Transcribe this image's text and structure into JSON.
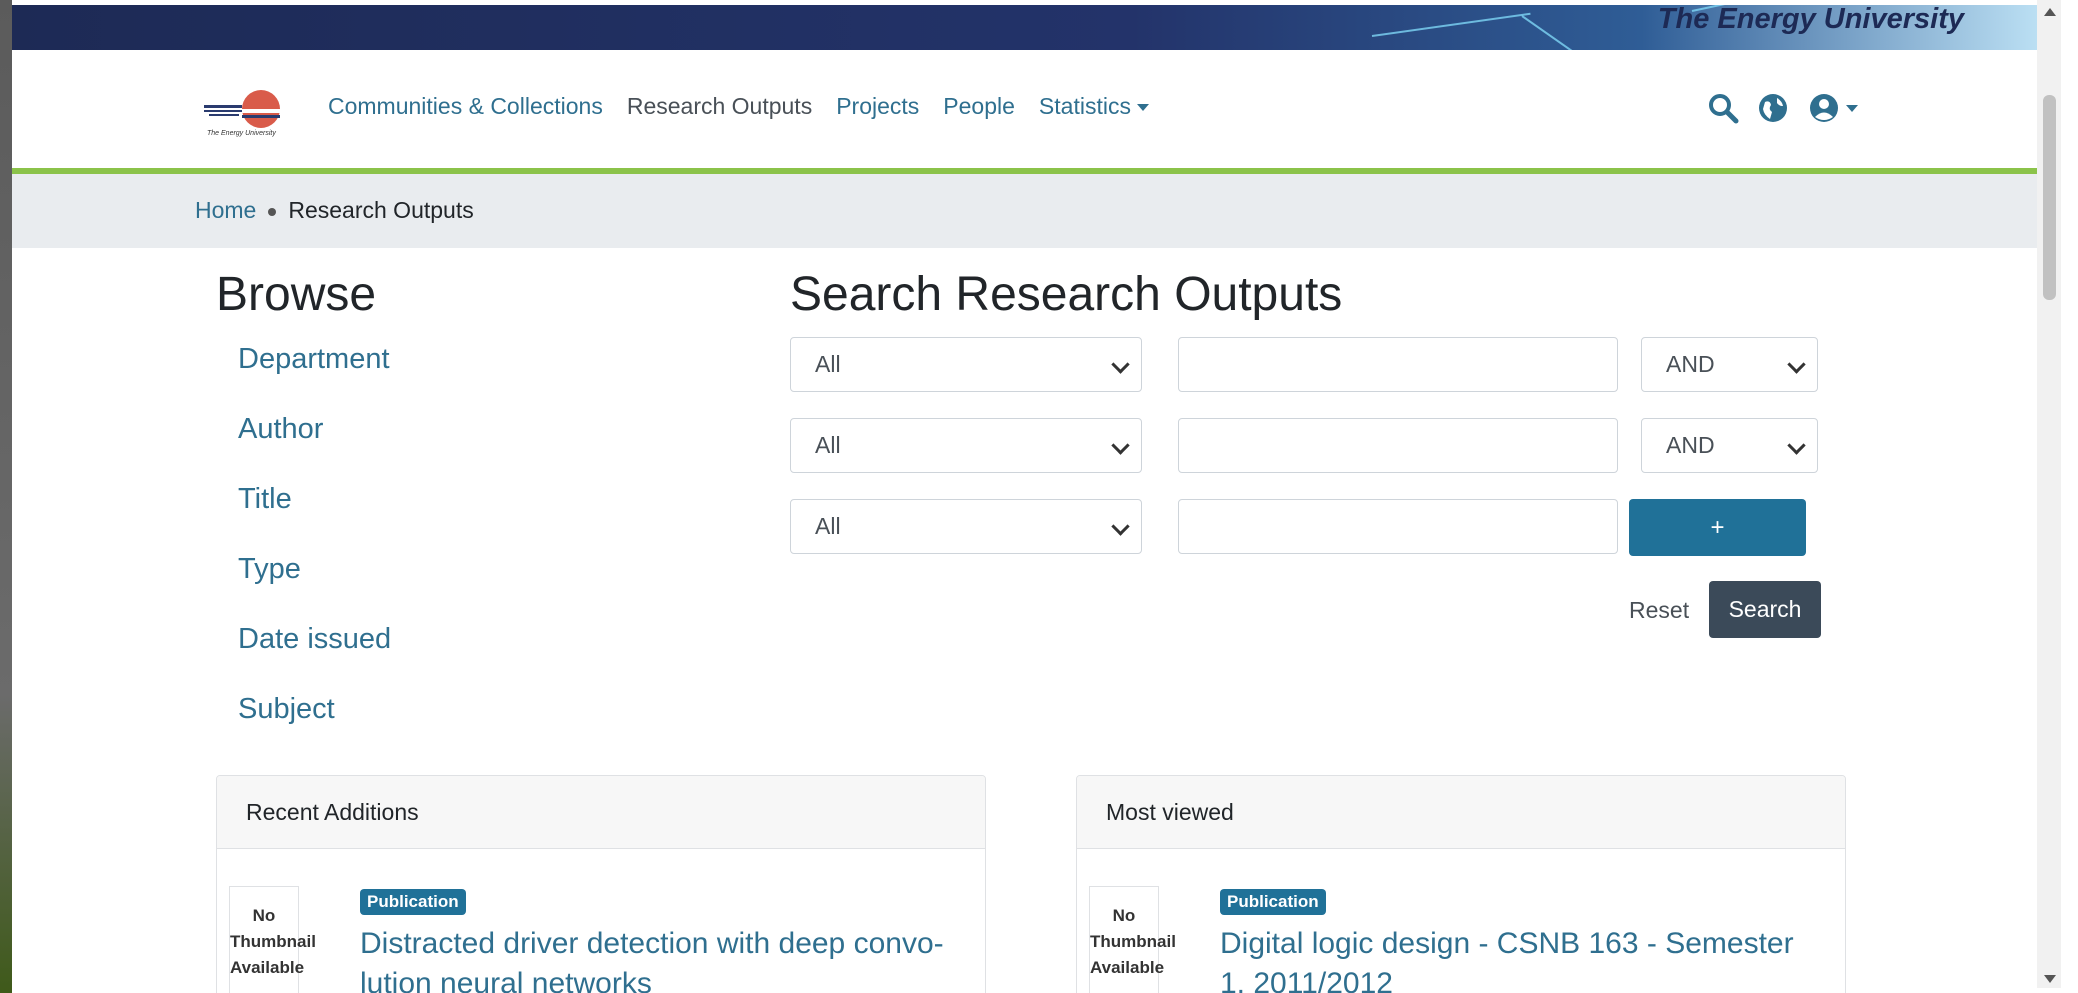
{
  "banner": {
    "text": "The Energy University"
  },
  "logo": {
    "caption": "The Energy University"
  },
  "nav": {
    "links": [
      "Communities & Collections",
      "Research Outputs",
      "Projects",
      "People",
      "Statistics"
    ]
  },
  "icons": {
    "search": "search-icon",
    "globe": "globe-icon",
    "user": "user-icon"
  },
  "breadcrumb": {
    "home": "Home",
    "current": "Research Outputs"
  },
  "browse": {
    "title": "Browse",
    "items": [
      "Department",
      "Author",
      "Title",
      "Type",
      "Date issued",
      "Subject"
    ]
  },
  "search": {
    "title": "Search Research Outputs",
    "rows": [
      {
        "field": "All",
        "value": "",
        "operator": "AND"
      },
      {
        "field": "All",
        "value": "",
        "operator": "AND"
      },
      {
        "field": "All",
        "value": ""
      }
    ],
    "add_label": "+",
    "reset_label": "Reset",
    "search_label": "Search"
  },
  "recent": {
    "title": "Recent Additions",
    "item": {
      "thumbnail_line1": "No",
      "thumbnail_line2": "Thumbnail",
      "thumbnail_line3": "Available",
      "badge": "Publication",
      "title": "Distracted driver detection with deep convo-lution neural networks"
    }
  },
  "most_viewed": {
    "title": "Most viewed",
    "item": {
      "thumbnail_line1": "No",
      "thumbnail_line2": "Thumbnail",
      "thumbnail_line3": "Available",
      "badge": "Publication",
      "title": "Digital logic design - CSNB 163 - Semester 1, 2011/2012"
    }
  },
  "colors": {
    "banner_dark": "#1d2a55",
    "accent_green": "#8bc34a",
    "link": "#2f6f8f",
    "primary_button": "#207198",
    "dark_button": "#3b4a59"
  }
}
